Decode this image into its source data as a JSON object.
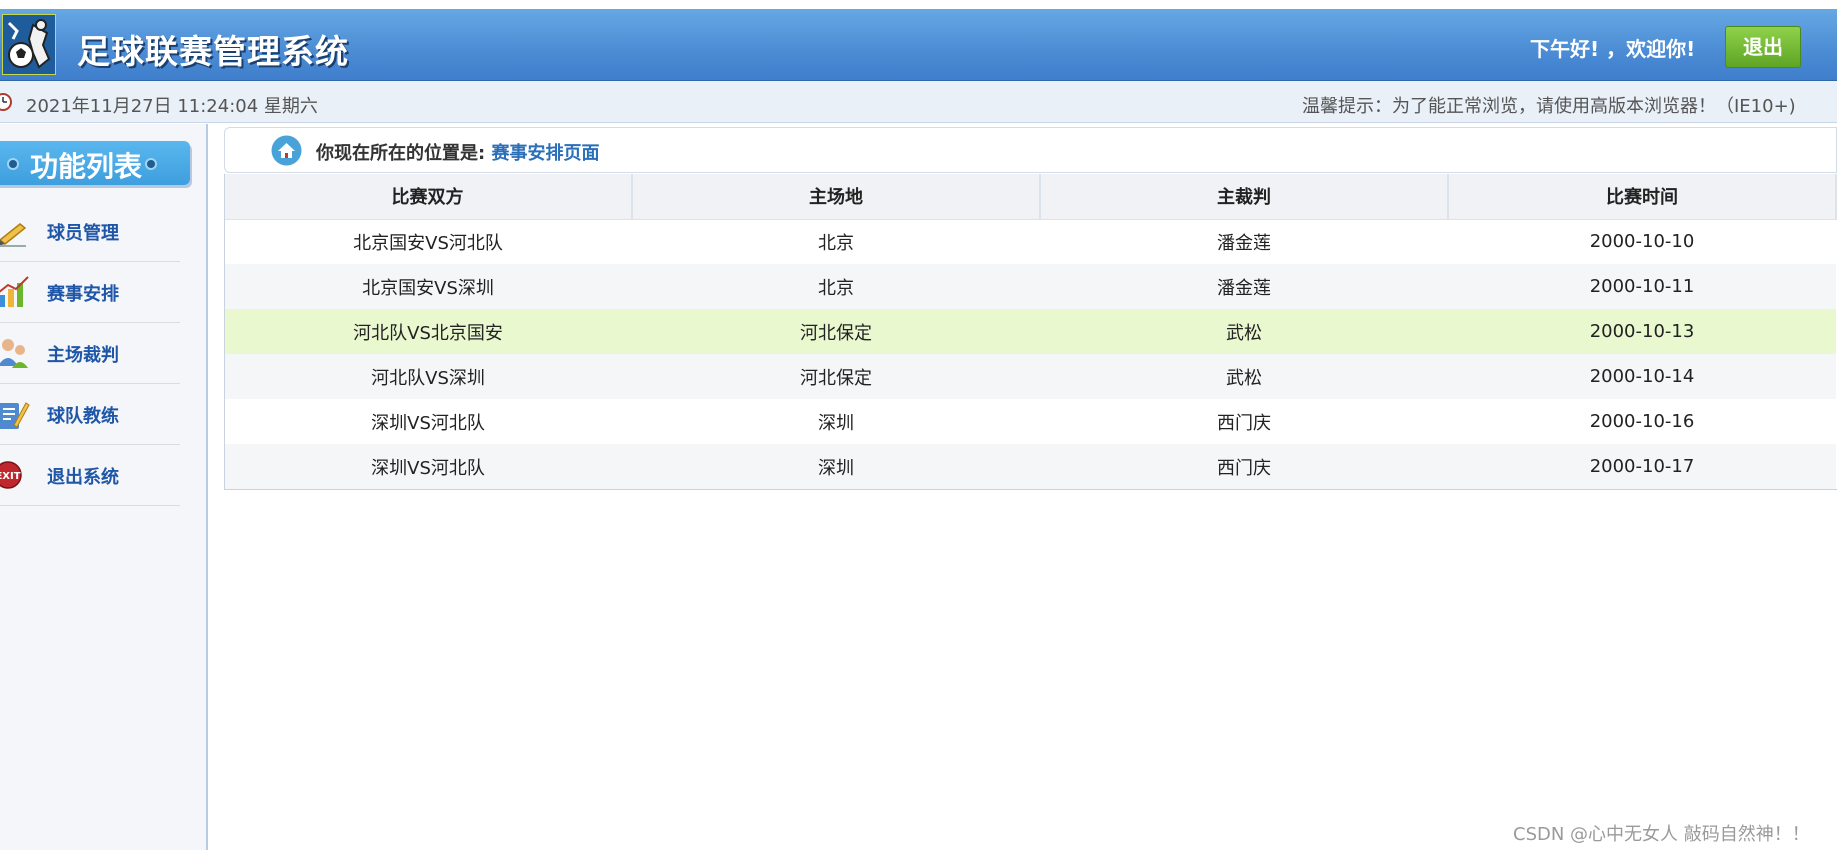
{
  "header": {
    "title": "足球联赛管理系统",
    "greeting": "下午好! ，欢迎你!",
    "logout_label": "退出",
    "logo_icon": "soccer-logo-icon"
  },
  "infobar": {
    "datetime": "2021年11月27日 11:24:04 星期六",
    "tip": "温馨提示：为了能正常浏览，请使用高版本浏览器！（IE10+)",
    "clock_icon": "clock-icon"
  },
  "sidebar": {
    "title": "功能列表",
    "items": [
      {
        "label": "球员管理",
        "icon": "pencil-icon"
      },
      {
        "label": "赛事安排",
        "icon": "chart-icon"
      },
      {
        "label": "主场裁判",
        "icon": "users-icon"
      },
      {
        "label": "球队教练",
        "icon": "clipboard-icon"
      },
      {
        "label": "退出系统",
        "icon": "exit-icon"
      }
    ]
  },
  "breadcrumb": {
    "label": "你现在所在的位置是: ",
    "page": "赛事安排页面",
    "icon": "home-icon"
  },
  "table": {
    "headers": [
      "比赛双方",
      "主场地",
      "主裁判",
      "比赛时间"
    ],
    "rows": [
      [
        "北京国安VS河北队",
        "北京",
        "潘金莲",
        "2000-10-10"
      ],
      [
        "北京国安VS深圳",
        "北京",
        "潘金莲",
        "2000-10-11"
      ],
      [
        "河北队VS北京国安",
        "河北保定",
        "武松",
        "2000-10-13"
      ],
      [
        "河北队VS深圳",
        "河北保定",
        "武松",
        "2000-10-14"
      ],
      [
        "深圳VS河北队",
        "深圳",
        "西门庆",
        "2000-10-16"
      ],
      [
        "深圳VS河北队",
        "深圳",
        "西门庆",
        "2000-10-17"
      ]
    ],
    "highlighted_row": 2
  },
  "watermark": "CSDN @心中无女人 敲码自然神！！",
  "colors": {
    "header_blue": "#4d8ed6",
    "logout_green": "#6cb52c",
    "nav_label": "#1f56a8",
    "highlight_row": "#eaf8d0"
  }
}
